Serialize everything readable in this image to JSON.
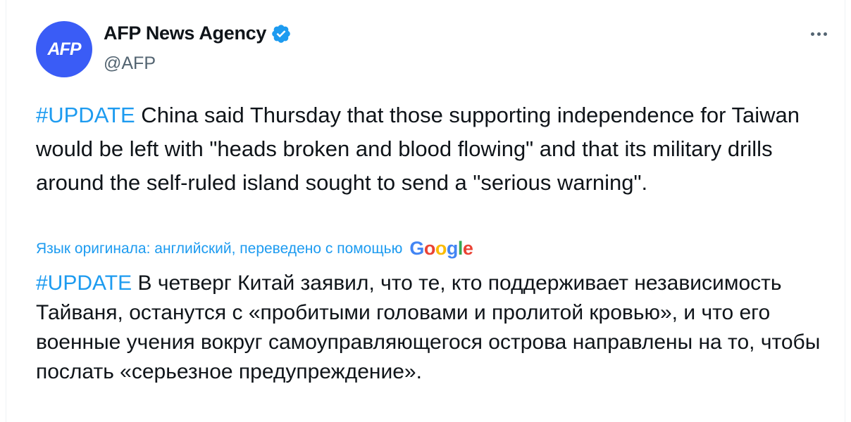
{
  "author": {
    "avatar_text": "AFP",
    "display_name": "AFP News Agency",
    "handle": "@AFP",
    "verified_icon": "verified-badge-icon"
  },
  "menu": {
    "icon": "more-horizontal-icon"
  },
  "tweet": {
    "hashtag": "#UPDATE",
    "text": " China said Thursday that those supporting independence for Taiwan would be left with \"heads broken and blood flowing\" and that its military drills around the self-ruled island sought to send a \"serious warning\"."
  },
  "translation": {
    "note": "Язык оригинала: английский, переведено с помощью",
    "provider": "Google",
    "hashtag": "#UPDATE",
    "text": " В четверг Китай заявил, что те, кто поддерживает независимость Тайваня, останутся с «пробитыми головами и пролитой кровью», и что его военные учения вокруг самоуправляющегося острова направлены на то, чтобы послать «серьезное предупреждение»."
  },
  "colors": {
    "accent": "#1d9bf0",
    "text": "#0f1419",
    "muted": "#536471",
    "avatar_bg": "#3a5cf6"
  }
}
